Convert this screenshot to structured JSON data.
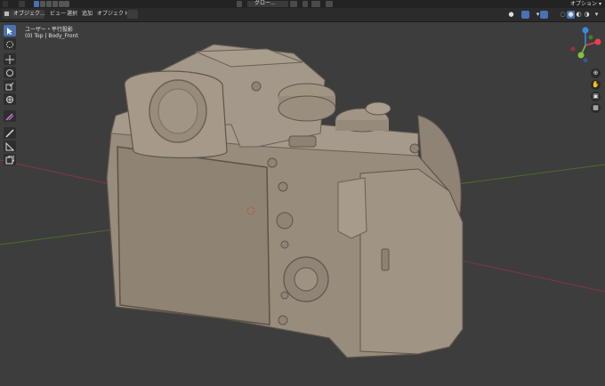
{
  "header": {
    "mode_label": "オブジェク...",
    "menus": [
      "ビュー",
      "選択",
      "追加",
      "オブジェクト"
    ],
    "transform_orientation": "グロー...",
    "options_label": "オプション"
  },
  "viewport": {
    "view_name": "ユーザー・平行投影",
    "collection_object": "(0) Top | Body_Front"
  },
  "toolbar": {
    "tools": [
      "select-box",
      "cursor",
      "move",
      "rotate",
      "scale",
      "transform",
      "annotate",
      "measure",
      "add-cube"
    ],
    "active": "select-box"
  },
  "gizmo": {
    "axes": [
      "X",
      "Y",
      "Z"
    ],
    "colors": {
      "x": "#e8414a",
      "y": "#84c23a",
      "z": "#3d89e6"
    }
  },
  "colors": {
    "accent": "#4772b3",
    "grid_x": "#9a3a48",
    "grid_y": "#5a7a32",
    "model": "#9b8f80"
  }
}
